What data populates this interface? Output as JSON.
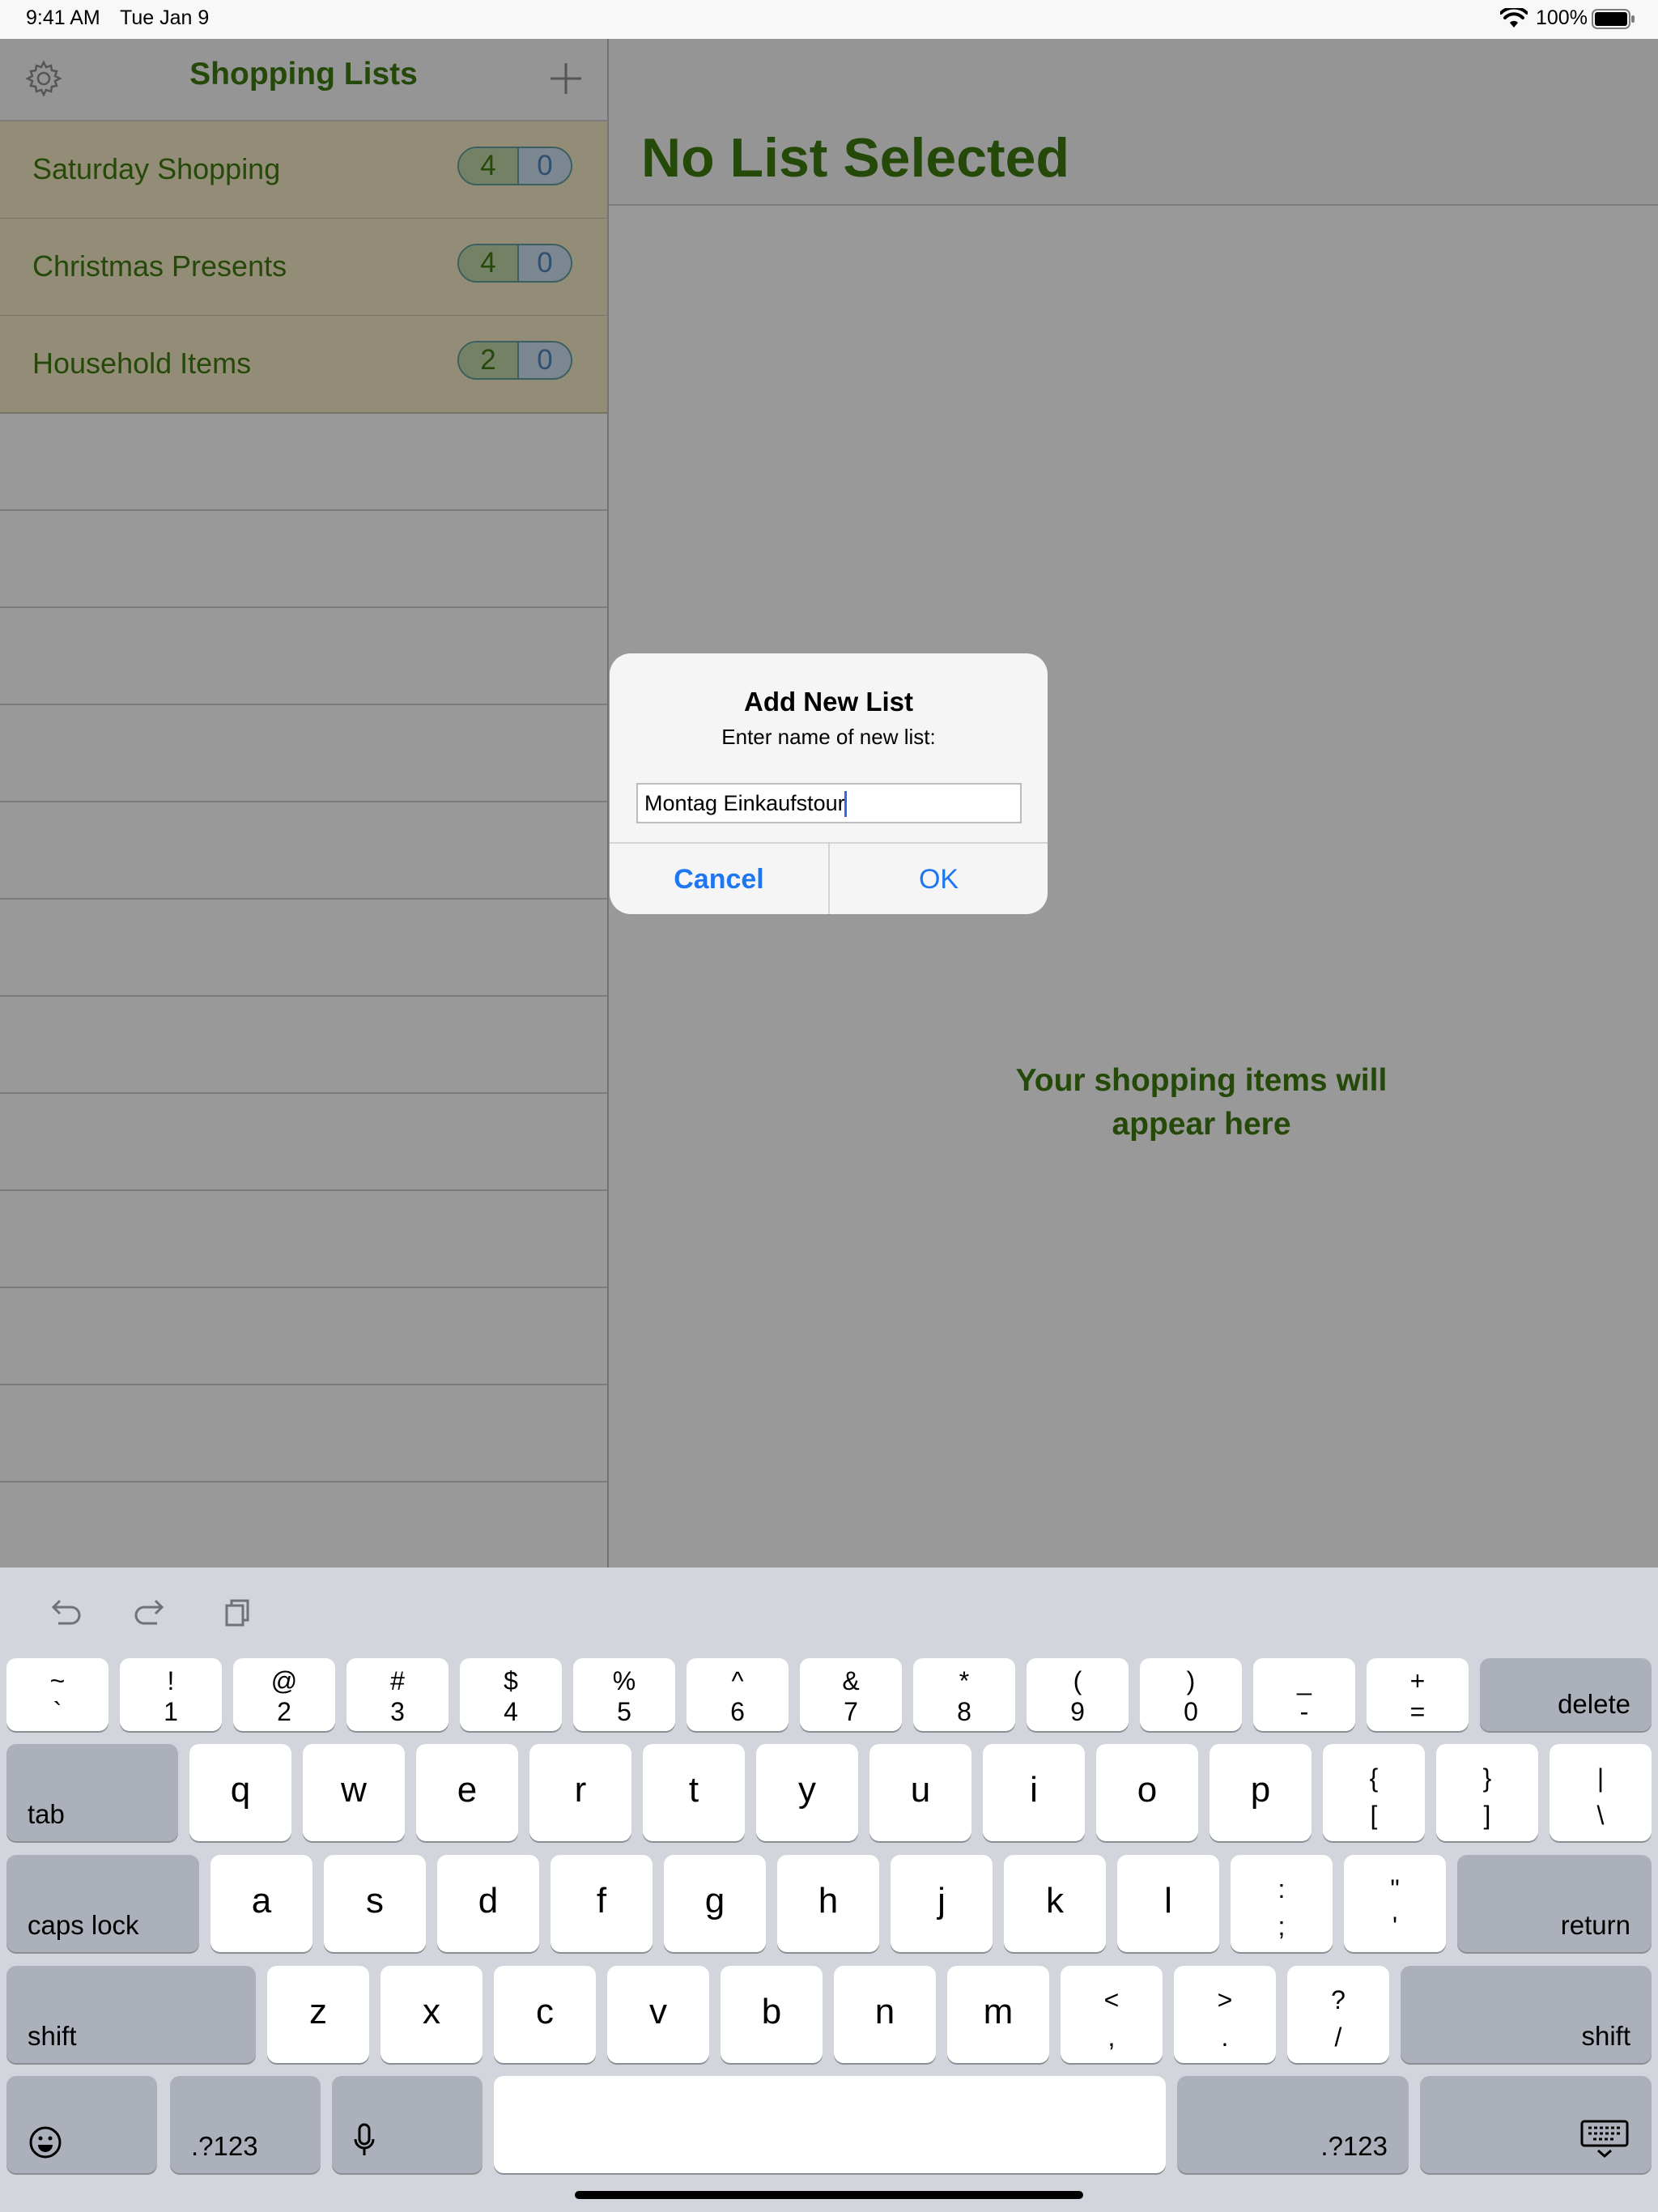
{
  "status_bar": {
    "time": "9:41 AM",
    "date": "Tue Jan 9",
    "battery": "100%"
  },
  "sidebar": {
    "title": "Shopping Lists",
    "lists": [
      {
        "name": "Saturday Shopping",
        "open_count": "4",
        "done_count": "0"
      },
      {
        "name": "Christmas Presents",
        "open_count": "4",
        "done_count": "0"
      },
      {
        "name": "Household Items",
        "open_count": "2",
        "done_count": "0"
      }
    ]
  },
  "detail": {
    "title": "No List Selected",
    "empty_message_line1": "Your shopping items will",
    "empty_message_line2": "appear here"
  },
  "alert": {
    "title": "Add New List",
    "message": "Enter name of new list:",
    "input_value": "Montag Einkaufstour",
    "cancel_label": "Cancel",
    "ok_label": "OK"
  },
  "keyboard": {
    "number_row": [
      {
        "top": "~",
        "bottom": "`"
      },
      {
        "top": "!",
        "bottom": "1"
      },
      {
        "top": "@",
        "bottom": "2"
      },
      {
        "top": "#",
        "bottom": "3"
      },
      {
        "top": "$",
        "bottom": "4"
      },
      {
        "top": "%",
        "bottom": "5"
      },
      {
        "top": "^",
        "bottom": "6"
      },
      {
        "top": "&",
        "bottom": "7"
      },
      {
        "top": "*",
        "bottom": "8"
      },
      {
        "top": "(",
        "bottom": "9"
      },
      {
        "top": ")",
        "bottom": "0"
      },
      {
        "top": "_",
        "bottom": "-"
      },
      {
        "top": "+",
        "bottom": "="
      }
    ],
    "delete_label": "delete",
    "tab_label": "tab",
    "row_q": [
      "q",
      "w",
      "e",
      "r",
      "t",
      "y",
      "u",
      "i",
      "o",
      "p"
    ],
    "row_q_symbols": [
      {
        "top": "{",
        "bottom": "["
      },
      {
        "top": "}",
        "bottom": "]"
      },
      {
        "top": "|",
        "bottom": "\\"
      }
    ],
    "caps_lock_label": "caps lock",
    "row_a": [
      "a",
      "s",
      "d",
      "f",
      "g",
      "h",
      "j",
      "k",
      "l"
    ],
    "row_a_symbols": [
      {
        "top": ":",
        "bottom": ";"
      },
      {
        "top": "\"",
        "bottom": "'"
      }
    ],
    "return_label": "return",
    "shift_label": "shift",
    "row_z": [
      "z",
      "x",
      "c",
      "v",
      "b",
      "n",
      "m"
    ],
    "row_z_symbols": [
      {
        "top": "<",
        "bottom": ","
      },
      {
        "top": ">",
        "bottom": "."
      },
      {
        "top": "?",
        "bottom": "/"
      }
    ],
    "numbers_label": ".?123",
    "icons": {
      "undo": "undo-icon",
      "redo": "redo-icon",
      "paste": "paste-icon",
      "emoji": "emoji-icon",
      "mic": "microphone-icon",
      "hide": "keyboard-hide-icon"
    }
  },
  "colors": {
    "accent_green": "#3f7a0f",
    "list_row_background": "#f6ebc9",
    "badge_open": "#c3d8a8",
    "badge_done": "#cfe1f2",
    "ios_blue": "#1d76f2",
    "keyboard_background": "#d2d5db"
  }
}
